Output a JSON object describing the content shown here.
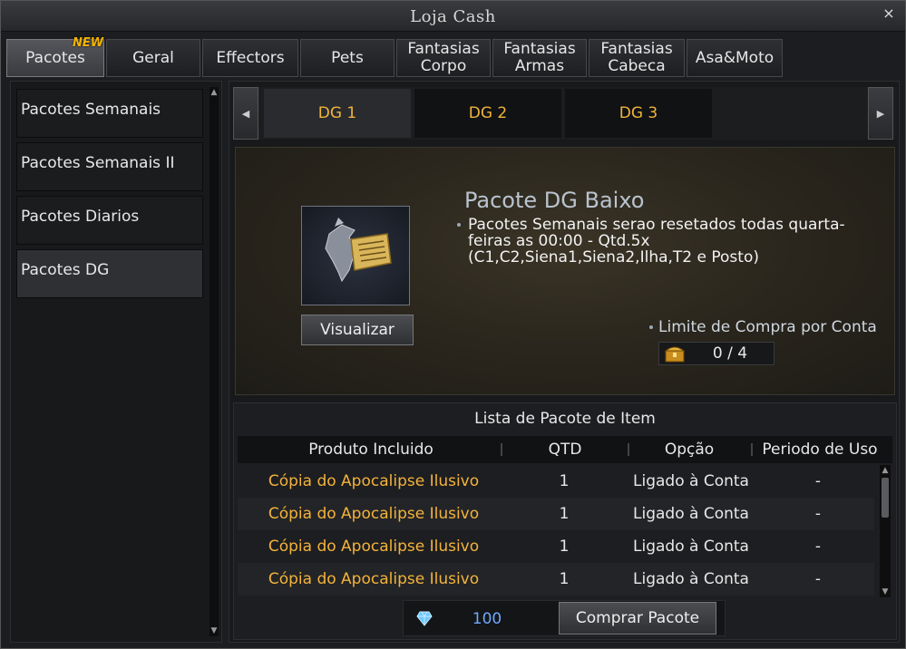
{
  "window": {
    "title": "Loja Cash",
    "close_glyph": "×"
  },
  "tabs": [
    {
      "label": "Pacotes",
      "active": true,
      "badge": "NEW"
    },
    {
      "label": "Geral"
    },
    {
      "label": "Effectors"
    },
    {
      "label": "Pets"
    },
    {
      "label": "Fantasias Corpo"
    },
    {
      "label": "Fantasias Armas"
    },
    {
      "label": "Fantasias Cabeca"
    },
    {
      "label": "Asa&Moto"
    }
  ],
  "sidebar": {
    "items": [
      {
        "label": "Pacotes Semanais"
      },
      {
        "label": "Pacotes Semanais II"
      },
      {
        "label": "Pacotes Diarios"
      },
      {
        "label": "Pacotes DG",
        "active": true
      }
    ]
  },
  "subtabs": [
    {
      "label": "DG 1",
      "active": true
    },
    {
      "label": "DG 2"
    },
    {
      "label": "DG 3"
    }
  ],
  "detail": {
    "title": "Pacote DG Baixo",
    "description": "Pacotes Semanais serao resetados todas quarta-feiras as 00:00 - Qtd.5x (C1,C2,Siena1,Siena2,Ilha,T2 e Posto)",
    "view_button": "Visualizar",
    "limit_label": "Limite de Compra por Conta",
    "limit_value": "0 / 4"
  },
  "list": {
    "title": "Lista de Pacote de Item",
    "columns": [
      "Produto Incluido",
      "QTD",
      "Opção",
      "Periodo de Uso"
    ],
    "rows": [
      {
        "product": "Cópia do Apocalipse Ilusivo",
        "qty": "1",
        "option": "Ligado à Conta",
        "period": "-"
      },
      {
        "product": "Cópia do Apocalipse Ilusivo",
        "qty": "1",
        "option": "Ligado à Conta",
        "period": "-"
      },
      {
        "product": "Cópia do Apocalipse Ilusivo",
        "qty": "1",
        "option": "Ligado à Conta",
        "period": "-"
      },
      {
        "product": "Cópia do Apocalipse Ilusivo",
        "qty": "1",
        "option": "Ligado à Conta",
        "period": "-"
      }
    ]
  },
  "footer": {
    "price": "100",
    "buy_button": "Comprar Pacote"
  },
  "icons": {
    "gem": "gem-icon",
    "chest": "chest-icon"
  },
  "colors": {
    "accent_gold": "#f3b33b",
    "price_blue": "#6fa8ff"
  }
}
